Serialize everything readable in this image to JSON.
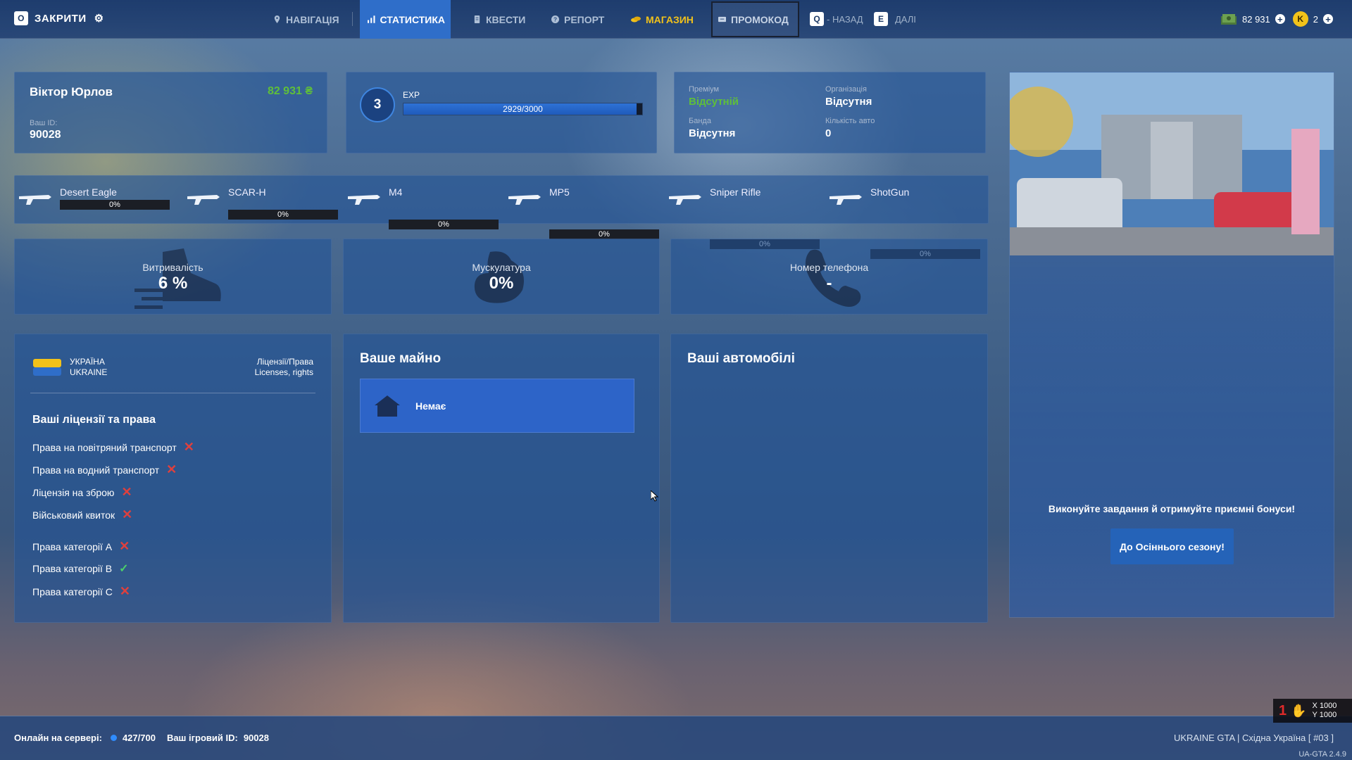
{
  "topbar": {
    "close_key": "O",
    "close_label": "ЗАКРИТИ",
    "nav": [
      {
        "label": "НАВІГАЦІЯ",
        "icon": "location-pin-icon"
      },
      {
        "label": "СТАТИСТИКА",
        "icon": "bar-chart-icon"
      },
      {
        "label": "КВЕСТИ",
        "icon": "scroll-icon"
      },
      {
        "label": "РЕПОРТ",
        "icon": "help-icon"
      },
      {
        "label": "МАГАЗИН",
        "icon": "coins-icon"
      },
      {
        "label": "ПРОМОКОД",
        "icon": "ticket-icon"
      }
    ],
    "back_key": "Q",
    "back_label": "- НАЗАД",
    "next_key": "E",
    "next_label": "ДАЛІ",
    "money": "82 931",
    "coin_letter": "K",
    "coins": "2"
  },
  "profile": {
    "name": "Віктор Юрлов",
    "money": "82 931 ₴",
    "id_label": "Ваш ID:",
    "id": "90028"
  },
  "level": {
    "level": "3",
    "exp_label": "EXP",
    "exp_text": "2929/3000",
    "exp_fraction": 0.976
  },
  "status": {
    "premium_label": "Преміум",
    "premium_value": "Відсутній",
    "org_label": "Організація",
    "org_value": "Відсутня",
    "gang_label": "Банда",
    "gang_value": "Відсутня",
    "cars_label": "Кількість авто",
    "cars_value": "0"
  },
  "weapons": [
    {
      "name": "Desert Eagle",
      "skill": "0%"
    },
    {
      "name": "SCAR-H",
      "skill": "0%"
    },
    {
      "name": "M4",
      "skill": "0%"
    },
    {
      "name": "MP5",
      "skill": "0%"
    },
    {
      "name": "Sniper Rifle",
      "skill": "0%"
    },
    {
      "name": "ShotGun",
      "skill": "0%"
    }
  ],
  "stats": {
    "stamina_label": "Витривалість",
    "stamina_value": "6 %",
    "muscle_label": "Мускулатура",
    "muscle_value": "0%",
    "phone_label": "Номер телефона",
    "phone_value": "-"
  },
  "licenses": {
    "country_ua": "УКРАЇНА",
    "country_en": "UKRAINE",
    "right_ua": "Ліцензії/Права",
    "right_en": "Licenses, rights",
    "title": "Ваші ліцензії та права",
    "items": [
      {
        "label": "Права на повітряний транспорт",
        "has": false
      },
      {
        "label": "Права на водний транспорт",
        "has": false
      },
      {
        "label": "Ліцензія на зброю",
        "has": false
      },
      {
        "label": "Військовий квиток",
        "has": false
      },
      {
        "label": "Права категорії A",
        "has": false
      },
      {
        "label": "Права категорії B",
        "has": true
      },
      {
        "label": "Права категорії C",
        "has": false
      }
    ]
  },
  "property": {
    "title": "Ваше майно",
    "empty": "Немає"
  },
  "cars": {
    "title": "Ваші автомобілі"
  },
  "promo": {
    "text": "Виконуйте завдання й отримуйте приємні бонуси!",
    "button": "До Осіннього сезону!"
  },
  "footer": {
    "online_label": "Онлайн на сервері:",
    "online_value": "427/700",
    "game_id_label": "Ваш ігровий ID:",
    "game_id": "90028",
    "server": "UKRAINE GTA | Східна Україна [ #03 ]",
    "version": "UA-GTA 2.4.9",
    "coords_x": "X 1000",
    "coords_y": "Y 1000"
  },
  "colors": {
    "accent": "#2f6ec9",
    "shop": "#f2c21a",
    "money": "#5fbf3a",
    "premium": "#5fbf3a",
    "cross": "#e0403d",
    "tick": "#4bd06a"
  }
}
